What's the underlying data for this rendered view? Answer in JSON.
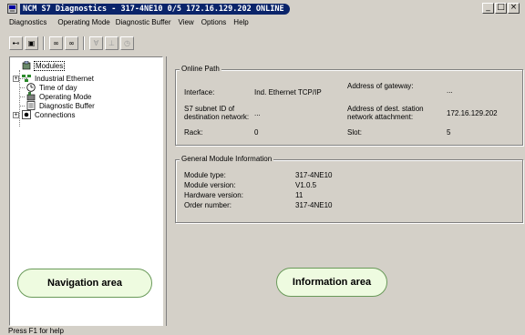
{
  "window": {
    "title": "NCM S7 Diagnostics - 317-4NE10 0/5 172.16.129.202  ONLINE",
    "controls": [
      "_",
      "□",
      "×"
    ]
  },
  "menu": [
    "Diagnostics",
    "Operating Mode",
    "Diagnostic Buffer",
    "View",
    "Options",
    "Help"
  ],
  "toolbar": {
    "buttons": [
      {
        "name": "connect-icon",
        "glyph": "⊷",
        "enabled": true
      },
      {
        "name": "disconnect-icon",
        "glyph": "▣",
        "enabled": true
      },
      {
        "name": "glasses-icon",
        "glyph": "∞",
        "enabled": true
      },
      {
        "name": "glasses-list-icon",
        "glyph": "∞",
        "enabled": true
      },
      {
        "name": "filter-icon",
        "glyph": "∀",
        "enabled": false
      },
      {
        "name": "stop-icon",
        "glyph": "⊥",
        "enabled": false
      },
      {
        "name": "clock-icon",
        "glyph": "◷",
        "enabled": false
      }
    ]
  },
  "tree": {
    "items": [
      {
        "label": "Modules",
        "icon": "modules-icon",
        "selected": true
      },
      {
        "label": "Industrial Ethernet",
        "icon": "network-icon",
        "selected": false,
        "expandable": true
      },
      {
        "label": "Time of day",
        "icon": "clock-icon",
        "selected": false
      },
      {
        "label": "Operating Mode",
        "icon": "operating-mode-icon",
        "selected": false
      },
      {
        "label": "Diagnostic Buffer",
        "icon": "buffer-icon",
        "selected": false
      },
      {
        "label": "Connections",
        "icon": "connections-icon",
        "selected": false,
        "expandable": true
      }
    ]
  },
  "online_path": {
    "title": "Online Path",
    "interface_label": "Interface:",
    "interface_value": "Ind. Ethernet TCP/IP",
    "gateway_label": "Address of gateway:",
    "gateway_value": "...",
    "subnet_label_1": "S7 subnet ID of",
    "subnet_label_2": "destination network:",
    "subnet_value": "...",
    "dest_label_1": "Address of dest. station",
    "dest_label_2": "network attachment:",
    "dest_value": "172.16.129.202",
    "rack_label": "Rack:",
    "rack_value": "0",
    "slot_label": "Slot:",
    "slot_value": "5"
  },
  "module_info": {
    "title": "General Module Information",
    "type_label": "Module type:",
    "type_value": "317-4NE10",
    "version_label": "Module version:",
    "version_value": "V1.0.5",
    "hw_label": "Hardware version:",
    "hw_value": "11",
    "order_label": "Order number:",
    "order_value": "317-4NE10"
  },
  "callouts": {
    "navigation": "Navigation area",
    "information": "Information area"
  },
  "status": "Press F1 for help",
  "colors": {
    "title_bg": "#0a246a",
    "callout_bg": "#eefbe0",
    "callout_border": "#6a9a5a",
    "face": "#d4d0c8"
  }
}
